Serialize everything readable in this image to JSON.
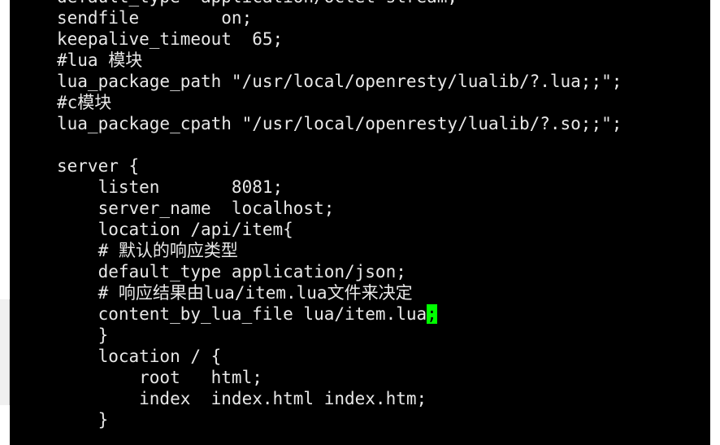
{
  "terminal": {
    "lines": [
      "default_type  application/octet-stream;",
      "sendfile        on;",
      "keepalive_timeout  65;",
      "#lua 模块",
      "lua_package_path \"/usr/local/openresty/lualib/?.lua;;\";",
      "#c模块",
      "lua_package_cpath \"/usr/local/openresty/lualib/?.so;;\";",
      "",
      "server {",
      "    listen       8081;",
      "    server_name  localhost;",
      "    location /api/item{",
      "    # 默认的响应类型",
      "    default_type application/json;",
      "    # 响应结果由lua/item.lua文件来决定",
      "    content_by_lua_file lua/item.lua",
      "    }",
      "    location / {",
      "        root   html;",
      "        index  index.html index.htm;",
      "    }"
    ],
    "cursor_char": ";"
  }
}
